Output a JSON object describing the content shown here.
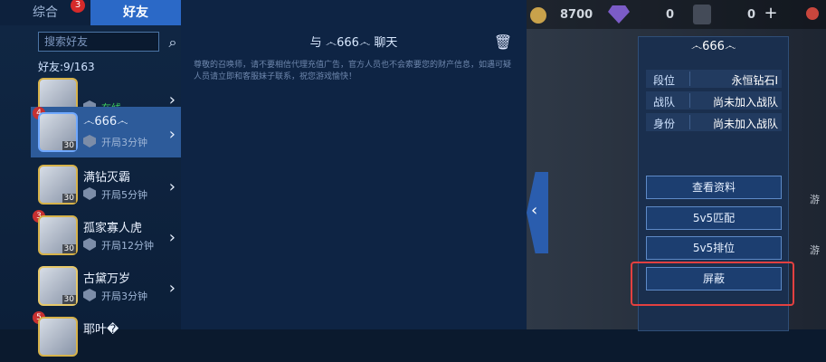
{
  "tabs": [
    {
      "label": "综合",
      "badge": "3"
    },
    {
      "label": "好友"
    }
  ],
  "search": {
    "placeholder": "搜索好友",
    "icon": "search-icon"
  },
  "friend_count": "好友:9/163",
  "friends": [
    {
      "name": "",
      "badge": "",
      "status": "在线",
      "level": ""
    },
    {
      "name": "෴666෴",
      "badge": "4",
      "status": "开局3分钟",
      "level": "30"
    },
    {
      "name": "满钻灭霸",
      "badge": "",
      "status": "开局5分钟",
      "level": "30"
    },
    {
      "name": "孤家寡人虎",
      "badge": "3",
      "status": "开局12分钟",
      "level": "30"
    },
    {
      "name": "古黛万岁",
      "badge": "",
      "status": "开局3分钟",
      "level": "30"
    },
    {
      "name": "耶叶�",
      "badge": "5",
      "status": "",
      "level": ""
    }
  ],
  "chat": {
    "title": "与 ෴666෴ 聊天",
    "notice": "尊敬的召唤师，请不要相信代理充值广告，官方人员也不会索要您的财产信息，如遇可疑人员请立即和客服妹子联系，祝您游戏愉快！"
  },
  "topbar": {
    "gold": "8700",
    "gems": "0",
    "tickets": "0",
    "plus": "+"
  },
  "profile": {
    "name": "෴666෴",
    "rows": [
      {
        "key": "段位",
        "value": "永恒钻石I"
      },
      {
        "key": "战队",
        "value": "尚未加入战队"
      },
      {
        "key": "身份",
        "value": "尚未加入战队"
      }
    ],
    "buttons": [
      "查看资料",
      "5v5匹配",
      "5v5排位",
      "屏蔽"
    ]
  },
  "side_labels": [
    "游",
    "游"
  ],
  "colors": {
    "accent": "#2b69c7",
    "highlight": "#e34040",
    "online": "#3ed35e"
  }
}
